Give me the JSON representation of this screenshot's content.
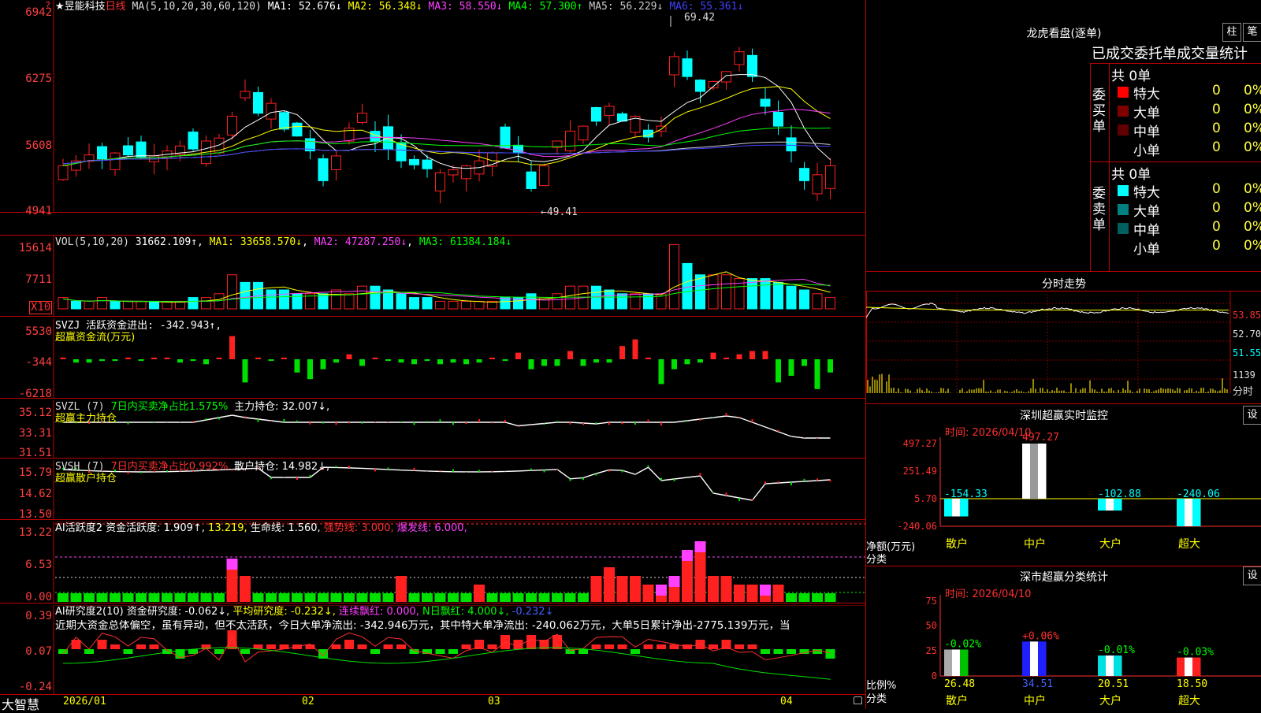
{
  "stock": {
    "name": "★昱能科技",
    "period": "日线",
    "ma_params": "MA(5,10,20,30,60,120)"
  },
  "main_chart": {
    "ma_values": [
      {
        "label": "MA1:",
        "value": "52.676↓",
        "color": "#ffffff"
      },
      {
        "label": "MA2:",
        "value": "56.348↓",
        "color": "#ffff00"
      },
      {
        "label": "MA3:",
        "value": "58.550↓",
        "color": "#ff40ff"
      },
      {
        "label": "MA4:",
        "value": "57.300↑",
        "color": "#00ff00"
      },
      {
        "label": "MA5:",
        "value": "56.229↓",
        "color": "#cccccc"
      },
      {
        "label": "MA6:",
        "value": "55.361↓",
        "color": "#4040ff"
      }
    ],
    "y_ticks": [
      "6942",
      "6275",
      "5608",
      "4941"
    ],
    "max_label": "69.42",
    "min_label": "←49.41",
    "top_mark": "?"
  },
  "vol_pane": {
    "title": "VOL(5,10,20)",
    "value": "31662.109↑",
    "ma1": "MA1: 33658.570↓",
    "ma2": "MA2: 47287.250↓",
    "ma3": "MA3: 61384.184↓",
    "y_ticks": [
      "15614",
      "7711"
    ],
    "unit": "X10"
  },
  "svzj_pane": {
    "title": "SVZJ  活跃资金进出: -342.943↑,",
    "subtitle": "超赢资金流(万元)",
    "y_ticks": [
      "5530",
      "-344",
      "-6218"
    ]
  },
  "svzl_pane": {
    "title": "SVZL (7)",
    "ratio": "7日内买卖净占比1.575%",
    "hold": "主力持仓: 32.007↓,",
    "subtitle": "超赢主力持仓",
    "y_ticks": [
      "35.12",
      "33.31",
      "31.51"
    ]
  },
  "svsh_pane": {
    "title": "SVSH (7)",
    "ratio": "7日内买卖净占比0.992%",
    "hold": "散户持仓: 14.982↓,",
    "subtitle": "超赢散户持仓",
    "y_ticks": [
      "15.79",
      "14.62",
      "13.50"
    ]
  },
  "ai_active": {
    "title": "AI活跃度2",
    "v1": "资金活跃度: 1.909↑,",
    "v2": "13.219,",
    "v3": "生命线: 1.560,",
    "v4": "强势线: 3.000,",
    "v5": "爆发线: 6.000,",
    "y_ticks": [
      "13.22",
      "6.53",
      "0.00"
    ]
  },
  "ai_research": {
    "title": "AI研究度2(10)",
    "v1": "资金研究度: -0.062↓,",
    "v2": "平均研究度: -0.232↓,",
    "v3": "连续飘红: 0.000,",
    "v4": "N日飘红: 4.000↓,",
    "v5": "-0.232↓",
    "comment": "近期大资金总体偏空，虽有异动，但不太活跃，今日大单净流出: -342.946万元，其中特大单净流出: -240.062万元，大单5日累计净出-2775.139万元，当",
    "y_ticks": [
      "0.39",
      "0.07",
      "-0.24"
    ]
  },
  "x_axis": {
    "labels": [
      "2026/01",
      "02",
      "03",
      "04"
    ],
    "brand": "大智慧"
  },
  "longhu": {
    "title": "龙虎看盘(逐单)",
    "btn1": "柱",
    "btn2": "笔",
    "header": "已成交委托单成交量统计",
    "buy": {
      "label": "委买单",
      "total": "共 0单",
      "rows": [
        {
          "name": "特大",
          "c1": "0",
          "c2": "0%",
          "color": "#ff0000"
        },
        {
          "name": "大单",
          "c1": "0",
          "c2": "0%",
          "color": "#800000"
        },
        {
          "name": "中单",
          "c1": "0",
          "c2": "0%",
          "color": "#600000"
        },
        {
          "name": "小单",
          "c1": "0",
          "c2": "0%",
          "color": "#000000"
        }
      ]
    },
    "sell": {
      "label": "委卖单",
      "total": "共 0单",
      "rows": [
        {
          "name": "特大",
          "c1": "0",
          "c2": "0%",
          "color": "#00ffff"
        },
        {
          "name": "大单",
          "c1": "0",
          "c2": "0%",
          "color": "#008080"
        },
        {
          "name": "中单",
          "c1": "0",
          "c2": "0%",
          "color": "#006060"
        },
        {
          "name": "小单",
          "c1": "0",
          "c2": "0%",
          "color": "#000000"
        }
      ]
    }
  },
  "intraday": {
    "title": "分时走势",
    "price_ticks": [
      "53.85",
      "52.70",
      "51.55"
    ],
    "vol_tick": "1139",
    "vol_unit": "分时"
  },
  "monitor": {
    "title": "深圳超赢实时监控",
    "btn": "设",
    "time": "时间: 2026/04/10",
    "y_ticks": [
      "497.27",
      "251.49",
      "5.70",
      "-240.06"
    ],
    "ylabel": "净额(万元)",
    "xlabel": "分类",
    "chart_data": {
      "type": "bar",
      "categories": [
        "散户",
        "中户",
        "大户",
        "超大"
      ],
      "values": [
        -154.33,
        497.27,
        -102.88,
        -240.06
      ],
      "labels": [
        "-154.33",
        "497.27",
        "-102.88",
        "-240.06"
      ],
      "ylim": [
        -240.06,
        497.27
      ]
    }
  },
  "classify": {
    "title": "深市超赢分类统计",
    "btn": "设",
    "time": "时间: 2026/04/10",
    "y_ticks": [
      "75",
      "50",
      "25",
      "0"
    ],
    "ylabel": "比例%",
    "xlabel": "分类",
    "chart_data": {
      "type": "bar",
      "categories": [
        "散户",
        "中户",
        "大户",
        "超大"
      ],
      "values": [
        26.48,
        34.51,
        20.51,
        18.5
      ],
      "changes": [
        "-0.02%",
        "+0.06%",
        "-0.01%",
        "-0.03%"
      ],
      "labels": [
        "26.48",
        "34.51",
        "20.51",
        "18.50"
      ],
      "ylim": [
        0,
        75
      ]
    }
  },
  "colors": {
    "up": "#ff2020",
    "down": "#00ffff",
    "grid": "#800000",
    "axis": "#ff3030"
  }
}
